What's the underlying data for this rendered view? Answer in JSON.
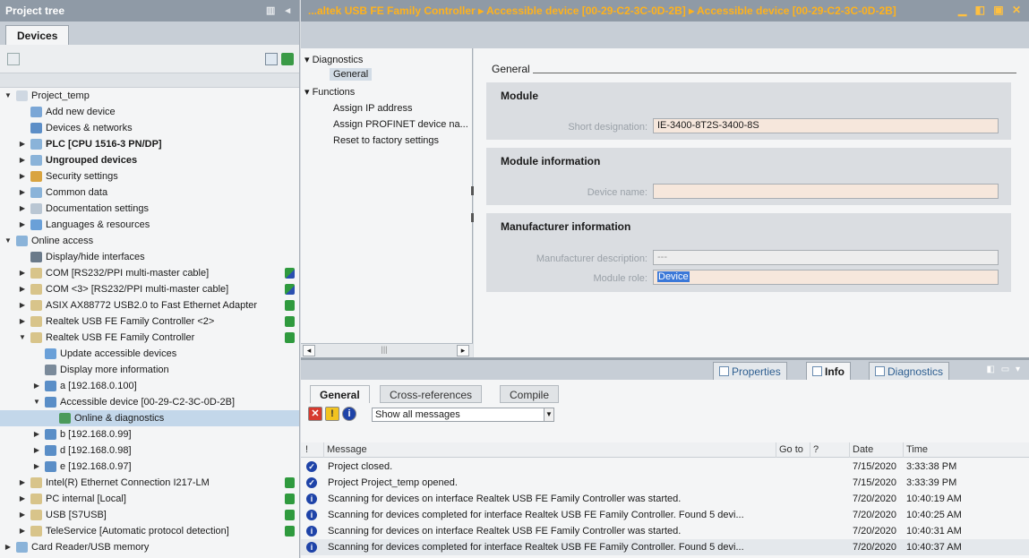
{
  "project_tree": {
    "title": "Project tree",
    "tab": "Devices",
    "items": [
      {
        "label": "Project_temp",
        "level": 0,
        "expand": "open",
        "icon": "project-icon",
        "bold": false
      },
      {
        "label": "Add new device",
        "level": 1,
        "expand": "none",
        "icon": "add-device-icon"
      },
      {
        "label": "Devices & networks",
        "level": 1,
        "expand": "none",
        "icon": "network-icon"
      },
      {
        "label": "PLC [CPU 1516-3 PN/DP]",
        "level": 1,
        "expand": "closed",
        "icon": "plc-icon",
        "bold": true
      },
      {
        "label": "Ungrouped devices",
        "level": 1,
        "expand": "closed",
        "icon": "folder-icon",
        "bold": true
      },
      {
        "label": "Security settings",
        "level": 1,
        "expand": "closed",
        "icon": "security-icon"
      },
      {
        "label": "Common data",
        "level": 1,
        "expand": "closed",
        "icon": "common-data-icon"
      },
      {
        "label": "Documentation settings",
        "level": 1,
        "expand": "closed",
        "icon": "documentation-icon"
      },
      {
        "label": "Languages & resources",
        "level": 1,
        "expand": "closed",
        "icon": "languages-icon"
      },
      {
        "label": "Online access",
        "level": 0,
        "expand": "open",
        "icon": "online-access-icon"
      },
      {
        "label": "Display/hide interfaces",
        "level": 1,
        "expand": "none",
        "icon": "filter-icon"
      },
      {
        "label": "COM [RS232/PPI multi-master cable]",
        "level": 1,
        "expand": "closed",
        "icon": "interface-icon",
        "status": "unknown"
      },
      {
        "label": "COM <3> [RS232/PPI multi-master cable]",
        "level": 1,
        "expand": "closed",
        "icon": "interface-icon",
        "status": "unknown"
      },
      {
        "label": "ASIX AX88772 USB2.0 to Fast Ethernet Adapter",
        "level": 1,
        "expand": "closed",
        "icon": "interface-icon",
        "status": "ok"
      },
      {
        "label": "Realtek USB FE Family Controller <2>",
        "level": 1,
        "expand": "closed",
        "icon": "interface-icon",
        "status": "ok"
      },
      {
        "label": "Realtek USB FE Family Controller",
        "level": 1,
        "expand": "open",
        "icon": "interface-icon",
        "status": "ok-check"
      },
      {
        "label": "Update accessible devices",
        "level": 2,
        "expand": "none",
        "icon": "update-icon"
      },
      {
        "label": "Display more information",
        "level": 2,
        "expand": "none",
        "icon": "info-icon"
      },
      {
        "label": "a [192.168.0.100]",
        "level": 2,
        "expand": "closed",
        "icon": "device-icon"
      },
      {
        "label": "Accessible device [00-29-C2-3C-0D-2B]",
        "level": 2,
        "expand": "open",
        "icon": "device-icon"
      },
      {
        "label": "Online & diagnostics",
        "level": 3,
        "expand": "none",
        "icon": "diagnostics-icon",
        "selected": true
      },
      {
        "label": "b [192.168.0.99]",
        "level": 2,
        "expand": "closed",
        "icon": "device-icon"
      },
      {
        "label": "d [192.168.0.98]",
        "level": 2,
        "expand": "closed",
        "icon": "device-icon"
      },
      {
        "label": "e [192.168.0.97]",
        "level": 2,
        "expand": "closed",
        "icon": "device-icon"
      },
      {
        "label": "Intel(R) Ethernet Connection I217-LM",
        "level": 1,
        "expand": "closed",
        "icon": "interface-icon",
        "status": "ok"
      },
      {
        "label": "PC internal [Local]",
        "level": 1,
        "expand": "closed",
        "icon": "interface-icon",
        "status": "ok"
      },
      {
        "label": "USB [S7USB]",
        "level": 1,
        "expand": "closed",
        "icon": "interface-icon",
        "status": "ok"
      },
      {
        "label": "TeleService [Automatic protocol detection]",
        "level": 1,
        "expand": "closed",
        "icon": "interface-icon",
        "status": "ok"
      },
      {
        "label": "Card Reader/USB memory",
        "level": 0,
        "expand": "closed",
        "icon": "card-reader-icon"
      }
    ]
  },
  "breadcrumb": {
    "part1": "...altek USB FE Family Controller",
    "sep": "▸",
    "part2": "Accessible device [00-29-C2-3C-0D-2B]",
    "part3": "Accessible device [00-29-C2-3C-0D-2B]"
  },
  "nav": {
    "diagnostics": "Diagnostics",
    "general": "General",
    "functions": "Functions",
    "assign_ip": "Assign IP address",
    "assign_name": "Assign PROFINET device na...",
    "reset": "Reset to factory settings"
  },
  "content": {
    "general_header": "General",
    "module": {
      "title": "Module",
      "short_label": "Short designation:",
      "short_value": "IE-3400-8T2S-3400-8S"
    },
    "module_info": {
      "title": "Module information",
      "device_name_label": "Device name:",
      "device_name_value": ""
    },
    "manufacturer": {
      "title": "Manufacturer information",
      "desc_label": "Manufacturer description:",
      "desc_value": "---",
      "role_label": "Module role:",
      "role_value": "Device"
    }
  },
  "inspector": {
    "tabs": {
      "properties": "Properties",
      "info": "Info",
      "diagnostics": "Diagnostics"
    },
    "subtabs": {
      "general": "General",
      "xref": "Cross-references",
      "compile": "Compile"
    },
    "filter": {
      "value": "Show all messages"
    },
    "columns": {
      "bang": "!",
      "message": "Message",
      "goto": "Go to",
      "q": "?",
      "date": "Date",
      "time": "Time"
    },
    "messages": [
      {
        "type": "ok",
        "text": "Project closed.",
        "date": "7/15/2020",
        "time": "3:33:38 PM"
      },
      {
        "type": "ok",
        "text": "Project Project_temp opened.",
        "date": "7/15/2020",
        "time": "3:33:39 PM"
      },
      {
        "type": "info",
        "text": "Scanning for devices on interface Realtek USB FE Family Controller was started.",
        "date": "7/20/2020",
        "time": "10:40:19 AM"
      },
      {
        "type": "info",
        "text": "Scanning for devices completed for interface Realtek USB FE Family Controller. Found 5 devi...",
        "date": "7/20/2020",
        "time": "10:40:25 AM"
      },
      {
        "type": "info",
        "text": "Scanning for devices on interface Realtek USB FE Family Controller was started.",
        "date": "7/20/2020",
        "time": "10:40:31 AM"
      },
      {
        "type": "info",
        "text": "Scanning for devices completed for interface Realtek USB FE Family Controller. Found 5 devi...",
        "date": "7/20/2020",
        "time": "10:40:37 AM"
      }
    ]
  },
  "colors": {
    "accent_title": "#ffb21c",
    "titlebar": "#8f9aa6",
    "status_ok": "#2f9a3e",
    "field_bg": "#f6e7dc",
    "selection": "#3b78d8"
  }
}
